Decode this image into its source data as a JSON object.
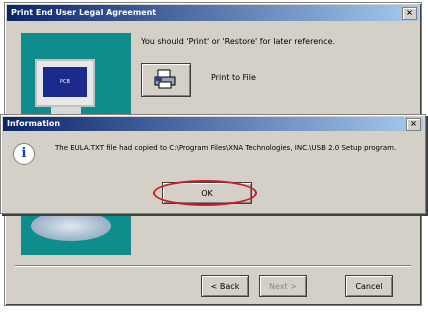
{
  "window": {
    "title": "Print End User Legal Agreement",
    "close_label": "×",
    "message": "You should 'Print' or 'Restore' for later reference.",
    "print_to_file_label": "Print to File",
    "monitor_text": "PCB",
    "buttons": {
      "back": "< Back",
      "next": "Next >",
      "cancel": "Cancel"
    }
  },
  "dialog": {
    "title": "Information",
    "close_label": "×",
    "icon_glyph": "i",
    "message": "The EULA.TXT file had copied to C:\\Program Files\\XNA Technologies, INC.\\USB 2.0 Setup program.",
    "ok_label": "OK",
    "highlight_color": "#d01a20"
  }
}
